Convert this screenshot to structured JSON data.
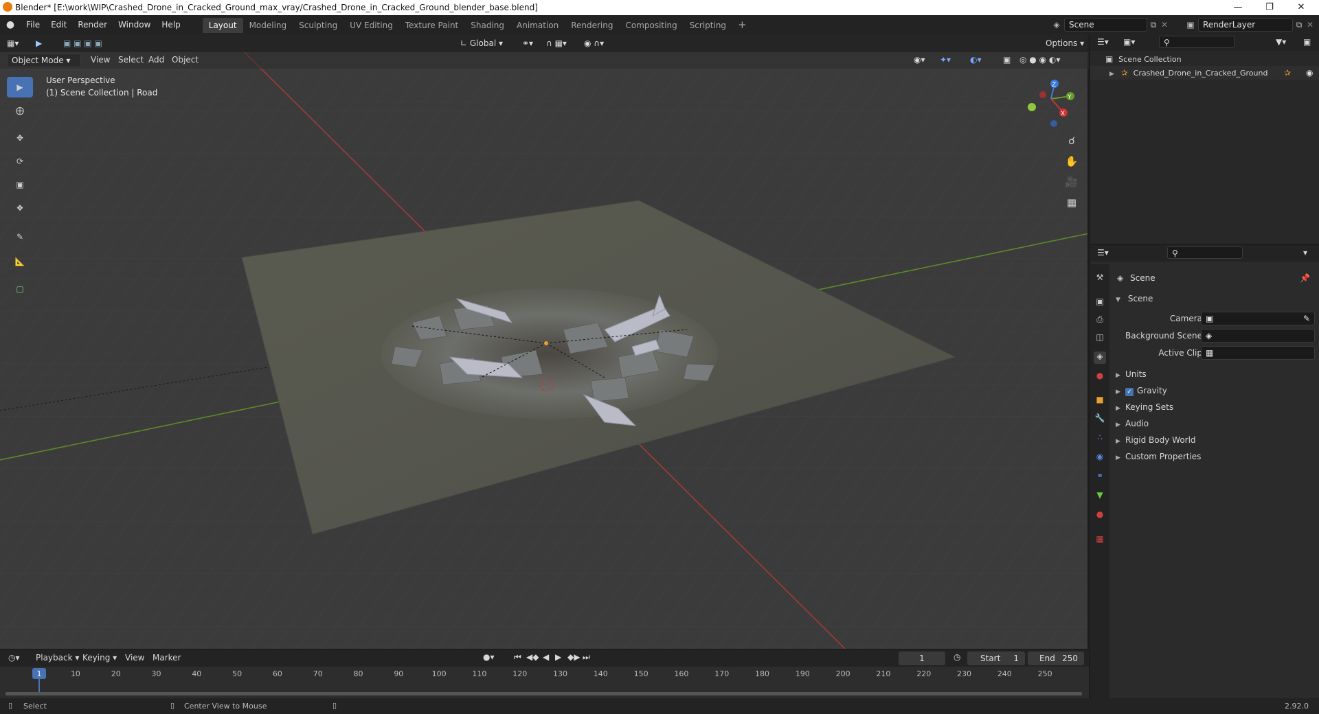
{
  "titlebar": {
    "title": "Blender* [E:\\work\\WIP\\Crashed_Drone_in_Cracked_Ground_max_vray/Crashed_Drone_in_Cracked_Ground_blender_base.blend]"
  },
  "menu": {
    "items": [
      "File",
      "Edit",
      "Render",
      "Window",
      "Help"
    ]
  },
  "workspaces": [
    "Layout",
    "Modeling",
    "Sculpting",
    "UV Editing",
    "Texture Paint",
    "Shading",
    "Animation",
    "Rendering",
    "Compositing",
    "Scripting"
  ],
  "scene_field": "Scene",
  "renderlayer_field": "RenderLayer",
  "viewport": {
    "mode": "Object Mode",
    "header_menus": [
      "View",
      "Select",
      "Add",
      "Object"
    ],
    "transform_orientation": "Global",
    "options_label": "Options",
    "overlay_title": "User Perspective",
    "overlay_subtitle": "(1) Scene Collection | Road",
    "gizmo": {
      "x": "X",
      "y": "Y",
      "z": "Z"
    }
  },
  "outliner": {
    "root": "Scene Collection",
    "items": [
      "Crashed_Drone_in_Cracked_Ground"
    ]
  },
  "properties": {
    "context": "Scene",
    "panel_title": "Scene",
    "fields": [
      {
        "label": "Camera"
      },
      {
        "label": "Background Scene"
      },
      {
        "label": "Active Clip"
      }
    ],
    "sections": [
      "Units",
      "Gravity",
      "Keying Sets",
      "Audio",
      "Rigid Body World",
      "Custom Properties"
    ],
    "gravity_checked": true
  },
  "timeline": {
    "menus": [
      "Playback",
      "Keying",
      "View",
      "Marker"
    ],
    "current_frame": "1",
    "start_label": "Start",
    "start_value": "1",
    "end_label": "End",
    "end_value": "250",
    "ticks": [
      "1",
      "10",
      "20",
      "30",
      "40",
      "50",
      "60",
      "70",
      "80",
      "90",
      "100",
      "110",
      "120",
      "130",
      "140",
      "150",
      "160",
      "170",
      "180",
      "190",
      "200",
      "210",
      "220",
      "230",
      "240",
      "250"
    ]
  },
  "statusbar": {
    "left": "Select",
    "middle": "Center View to Mouse",
    "version": "2.92.0"
  },
  "colors": {
    "accent": "#4772b3",
    "axis_x": "#b03a3a",
    "axis_y": "#6a9a2a"
  }
}
